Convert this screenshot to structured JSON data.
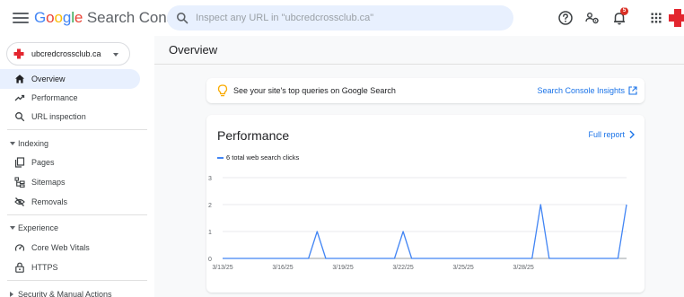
{
  "app": {
    "logo_google": [
      "G",
      "o",
      "o",
      "g",
      "l",
      "e"
    ],
    "logo_rest": " Search Console"
  },
  "search": {
    "placeholder": "Inspect any URL in \"ubcredcrossclub.ca\""
  },
  "notifications": {
    "count": "5"
  },
  "property": {
    "name": "ubcredcrossclub.ca"
  },
  "sidebar": {
    "overview": "Overview",
    "performance": "Performance",
    "url_inspection": "URL inspection",
    "indexing": "Indexing",
    "pages": "Pages",
    "sitemaps": "Sitemaps",
    "removals": "Removals",
    "experience": "Experience",
    "core_web_vitals": "Core Web Vitals",
    "https": "HTTPS",
    "security": "Security & Manual Actions"
  },
  "main": {
    "title": "Overview"
  },
  "insight": {
    "text": "See your site's top queries on Google Search",
    "link": "Search Console Insights"
  },
  "performance": {
    "title": "Performance",
    "full_report": "Full report"
  },
  "colors": {
    "accent": "#1a73e8",
    "series": "#4285f4",
    "active_nav": "#e8f0fe",
    "badge": "#d93025"
  },
  "chart_data": {
    "type": "line",
    "series": [
      {
        "name": "6 total web search clicks",
        "values": [
          0,
          0,
          0,
          0,
          0,
          0,
          0,
          0,
          0,
          0,
          0,
          1,
          0,
          0,
          0,
          0,
          0,
          0,
          0,
          0,
          0,
          1,
          0,
          0,
          0,
          0,
          0,
          0,
          0,
          0,
          0,
          0,
          0,
          0,
          0,
          0,
          0,
          2,
          0,
          0,
          0,
          0,
          0,
          0,
          0,
          0,
          0,
          2
        ]
      }
    ],
    "x_tick_labels": [
      "3/13/25",
      "3/16/25",
      "3/19/25",
      "3/22/25",
      "3/25/25",
      "3/28/25"
    ],
    "x_tick_positions": [
      0,
      7,
      14,
      21,
      28,
      35
    ],
    "y_ticks": [
      0,
      1,
      2,
      3
    ],
    "ylim": [
      0,
      3
    ],
    "grid": true,
    "legend": "top-left"
  }
}
